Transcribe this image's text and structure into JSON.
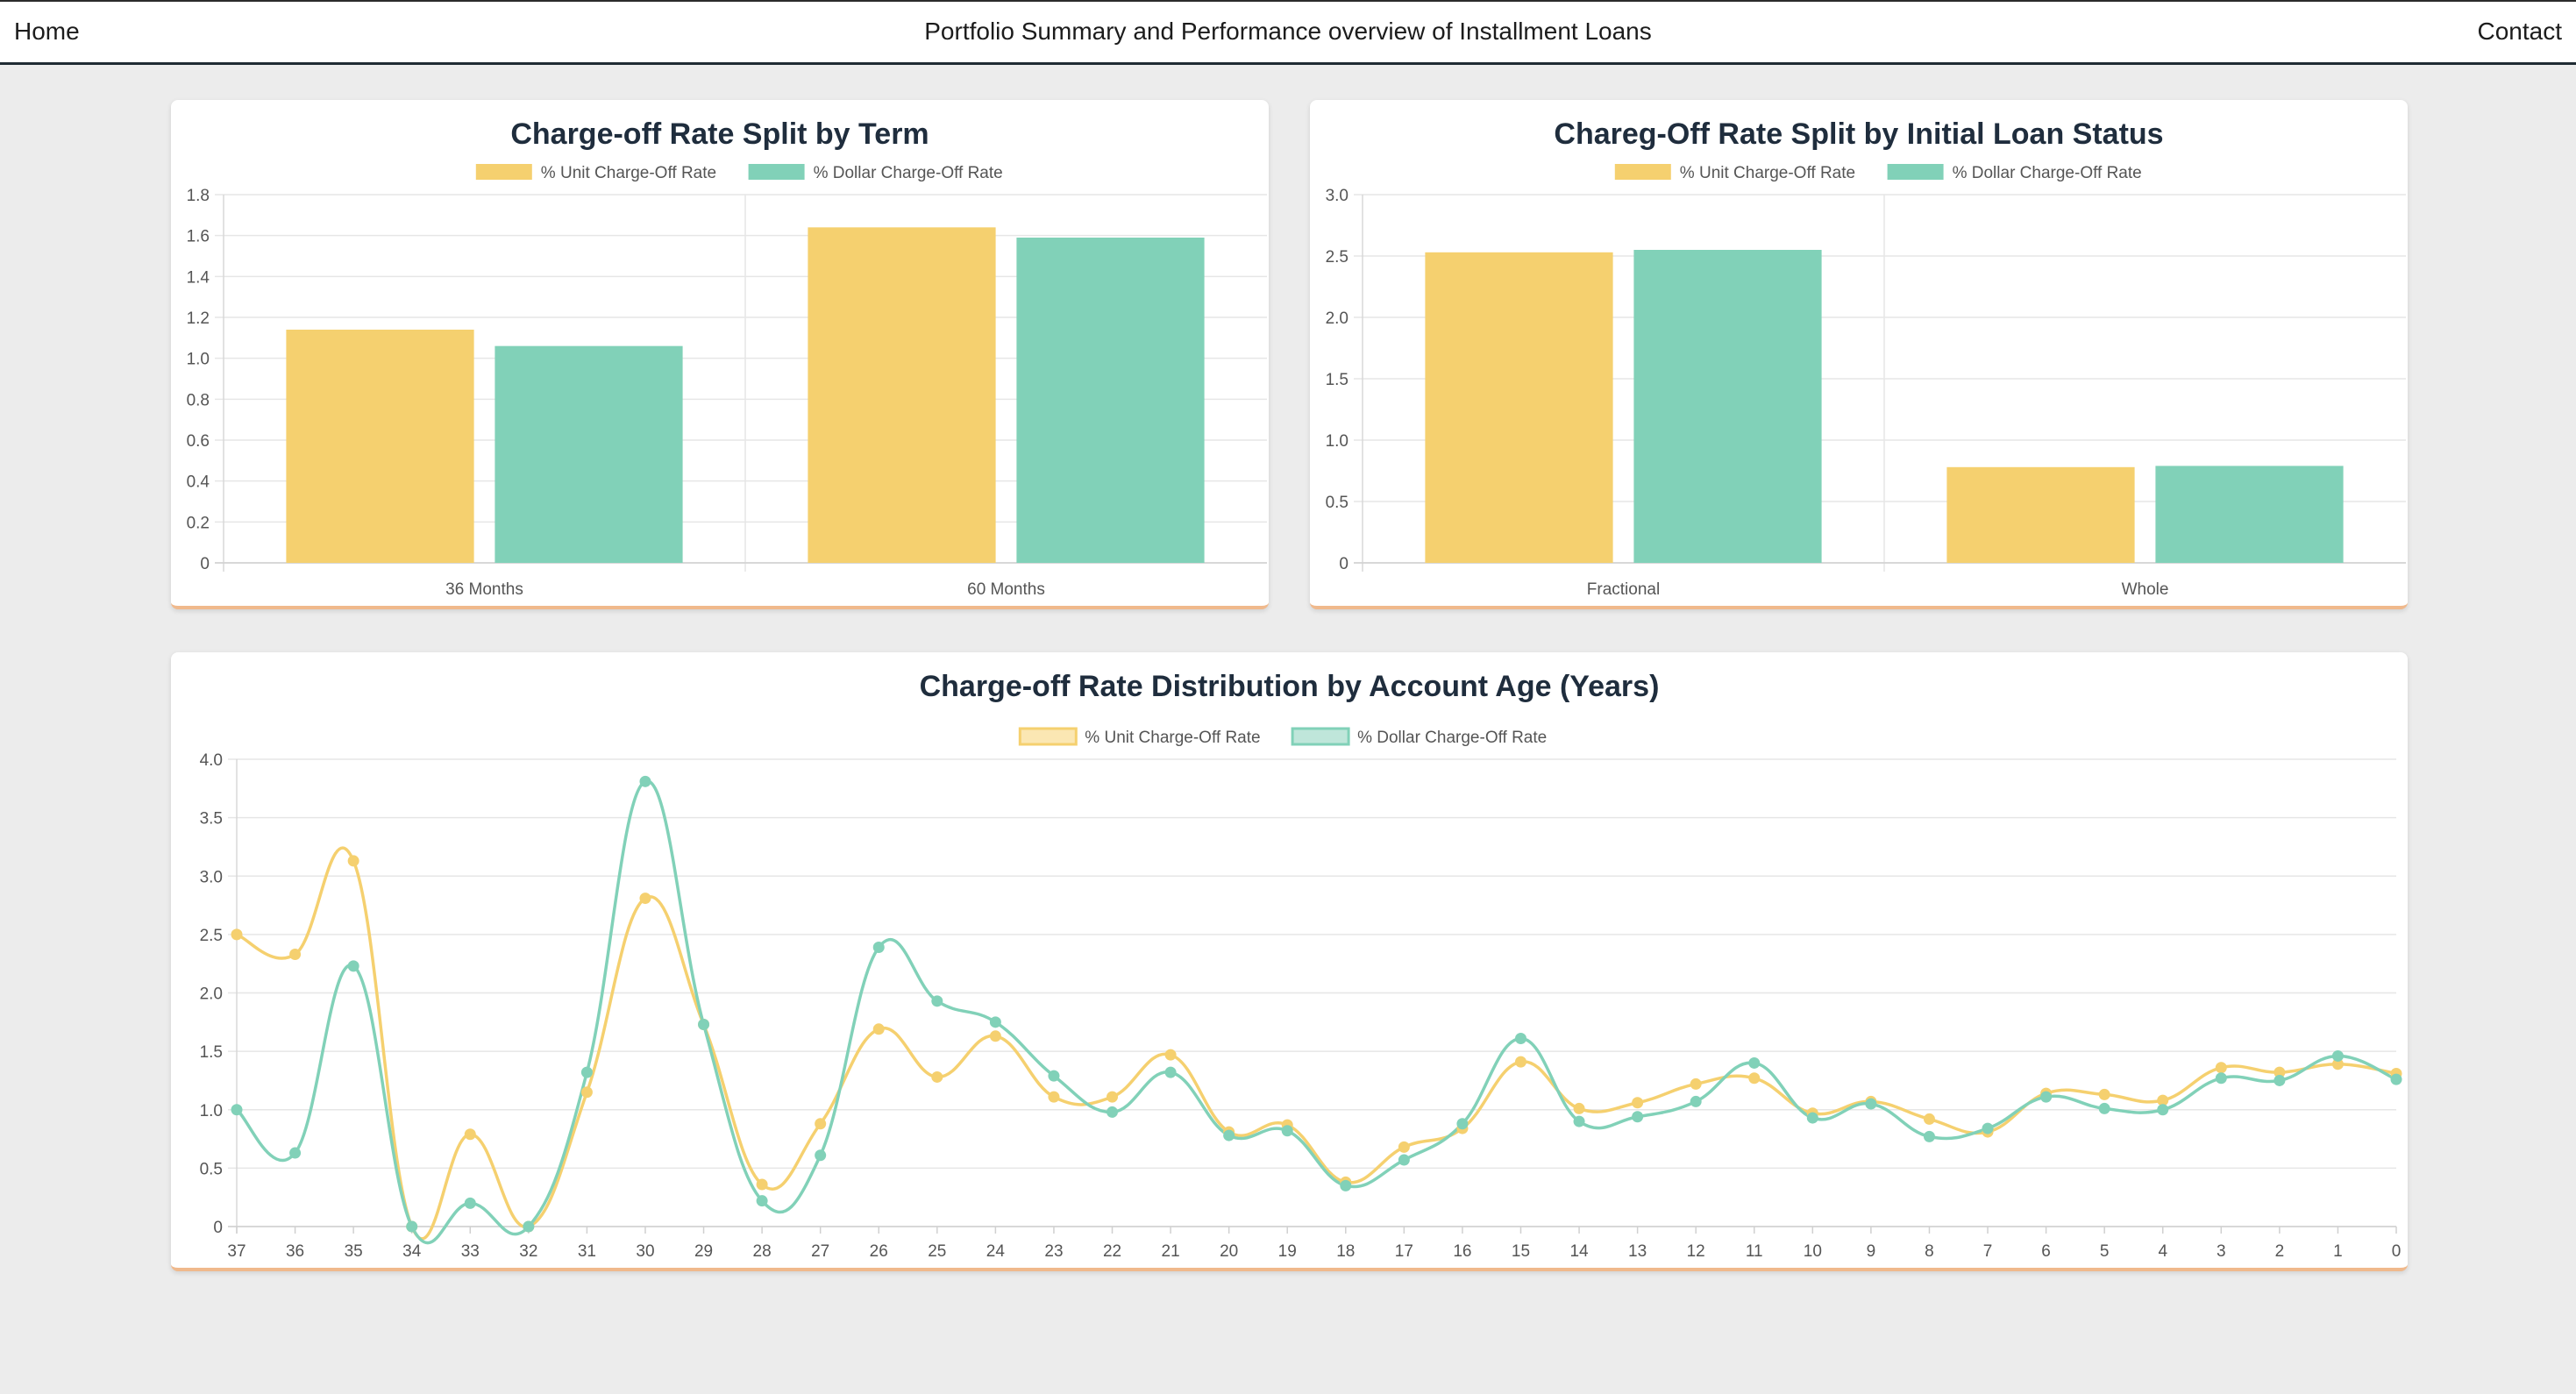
{
  "nav": {
    "home": "Home",
    "title": "Portfolio Summary and Performance overview of Installment Loans",
    "contact": "Contact"
  },
  "colors": {
    "unit": "#f5d06f",
    "dollar": "#81d1b8"
  },
  "chart_data": [
    {
      "type": "bar",
      "title": "Charge-off Rate Split by Term",
      "categories": [
        "36 Months",
        "60 Months"
      ],
      "series": [
        {
          "name": "% Unit Charge-Off Rate",
          "values": [
            1.14,
            1.64
          ]
        },
        {
          "name": "% Dollar Charge-Off Rate",
          "values": [
            1.06,
            1.59
          ]
        }
      ],
      "ylim": [
        0,
        1.8
      ],
      "yticks": [
        "0",
        "0.2",
        "0.4",
        "0.6",
        "0.8",
        "1.0",
        "1.2",
        "1.4",
        "1.6",
        "1.8"
      ],
      "legend": "top",
      "grid": true
    },
    {
      "type": "bar",
      "title": "Chareg-Off Rate Split by Initial Loan Status",
      "categories": [
        "Fractional",
        "Whole"
      ],
      "series": [
        {
          "name": "% Unit Charge-Off Rate",
          "values": [
            2.53,
            0.78
          ]
        },
        {
          "name": "% Dollar Charge-Off Rate",
          "values": [
            2.55,
            0.79
          ]
        }
      ],
      "ylim": [
        0,
        3.0
      ],
      "yticks": [
        "0",
        "0.5",
        "1.0",
        "1.5",
        "2.0",
        "2.5",
        "3.0"
      ],
      "legend": "top",
      "grid": true
    },
    {
      "type": "line",
      "title": "Charge-off Rate Distribution by Account Age (Years)",
      "x": [
        "37",
        "36",
        "35",
        "34",
        "33",
        "32",
        "31",
        "30",
        "29",
        "28",
        "27",
        "26",
        "25",
        "24",
        "23",
        "22",
        "21",
        "20",
        "19",
        "18",
        "17",
        "16",
        "15",
        "14",
        "13",
        "12",
        "11",
        "10",
        "9",
        "8",
        "7",
        "6",
        "5",
        "4",
        "3",
        "2",
        "1",
        "0"
      ],
      "series": [
        {
          "name": "% Unit Charge-Off Rate",
          "values": [
            2.5,
            2.33,
            3.13,
            0.0,
            0.79,
            0.0,
            1.15,
            2.81,
            1.73,
            0.36,
            0.88,
            1.69,
            1.28,
            1.63,
            1.11,
            1.11,
            1.47,
            0.81,
            0.87,
            0.38,
            0.68,
            0.84,
            1.41,
            1.01,
            1.06,
            1.22,
            1.27,
            0.97,
            1.07,
            0.92,
            0.81,
            1.14,
            1.13,
            1.08,
            1.36,
            1.32,
            1.39,
            1.31
          ]
        },
        {
          "name": "% Dollar Charge-Off Rate",
          "values": [
            1.0,
            0.63,
            2.23,
            0.0,
            0.2,
            0.0,
            1.32,
            3.81,
            1.73,
            0.22,
            0.61,
            2.39,
            1.93,
            1.75,
            1.29,
            0.98,
            1.32,
            0.78,
            0.82,
            0.35,
            0.57,
            0.88,
            1.61,
            0.9,
            0.94,
            1.07,
            1.4,
            0.93,
            1.05,
            0.77,
            0.84,
            1.11,
            1.01,
            1.0,
            1.27,
            1.25,
            1.46,
            1.26
          ]
        }
      ],
      "ylim": [
        0,
        4.0
      ],
      "yticks": [
        "0",
        "0.5",
        "1.0",
        "1.5",
        "2.0",
        "2.5",
        "3.0",
        "3.5",
        "4.0"
      ],
      "legend": "top",
      "grid": true
    }
  ]
}
